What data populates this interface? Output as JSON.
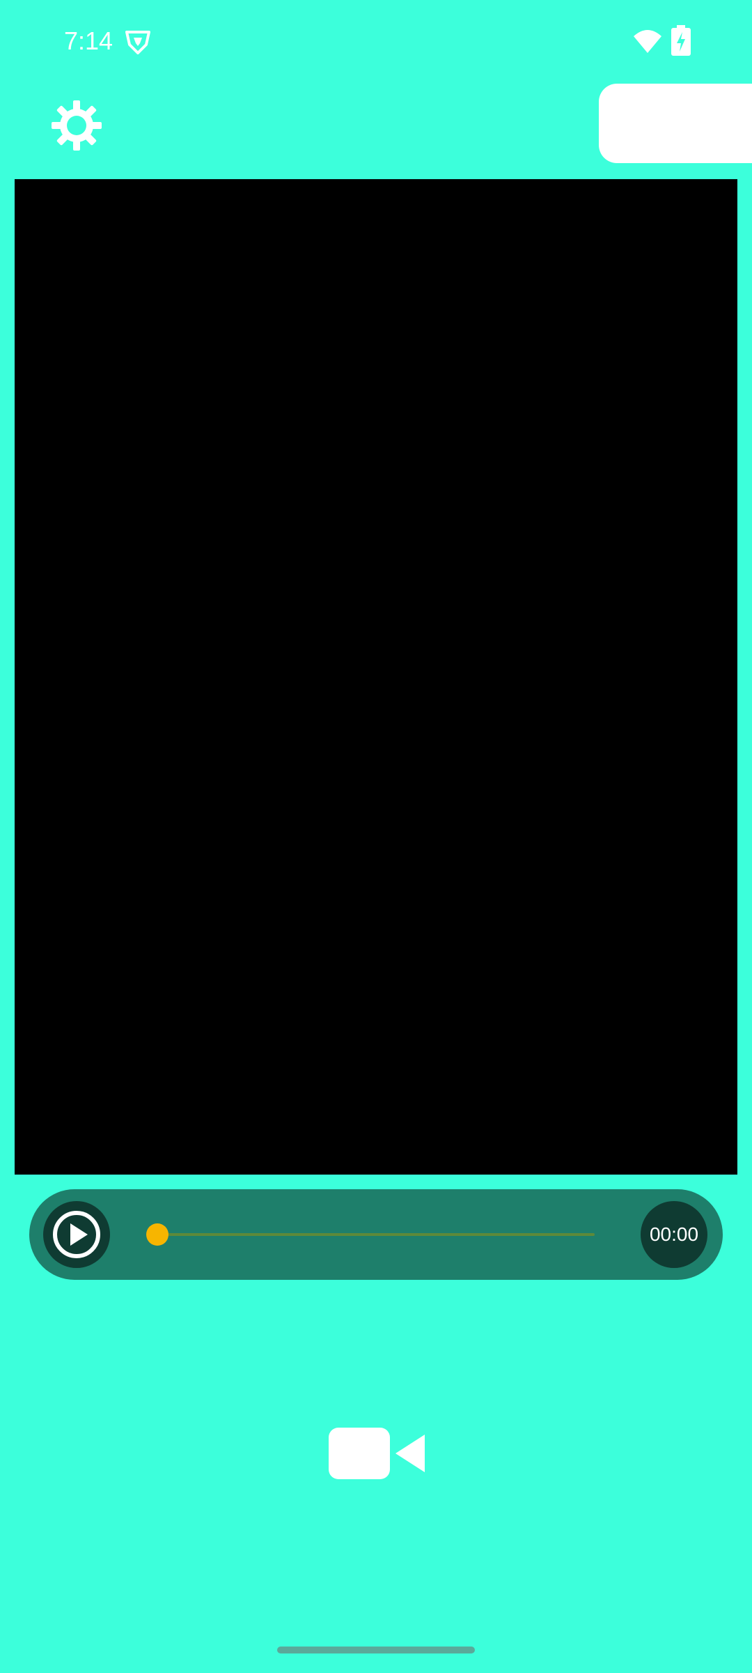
{
  "status_bar": {
    "time": "7:14",
    "icons": [
      "shield-icon",
      "wifi-icon",
      "battery-charging-icon"
    ]
  },
  "top_bar": {
    "settings_icon": "gear-icon"
  },
  "player": {
    "play_icon": "play-icon",
    "progress": 0,
    "time": "00:00"
  },
  "bottom": {
    "record_icon": "video-camera-icon"
  },
  "colors": {
    "background": "#3cffdb",
    "player_bar": "#1e7f6b",
    "player_button": "#0f3b32",
    "seek_thumb": "#f7b500",
    "seek_track": "#5e8a3a",
    "video_area": "#000000"
  }
}
